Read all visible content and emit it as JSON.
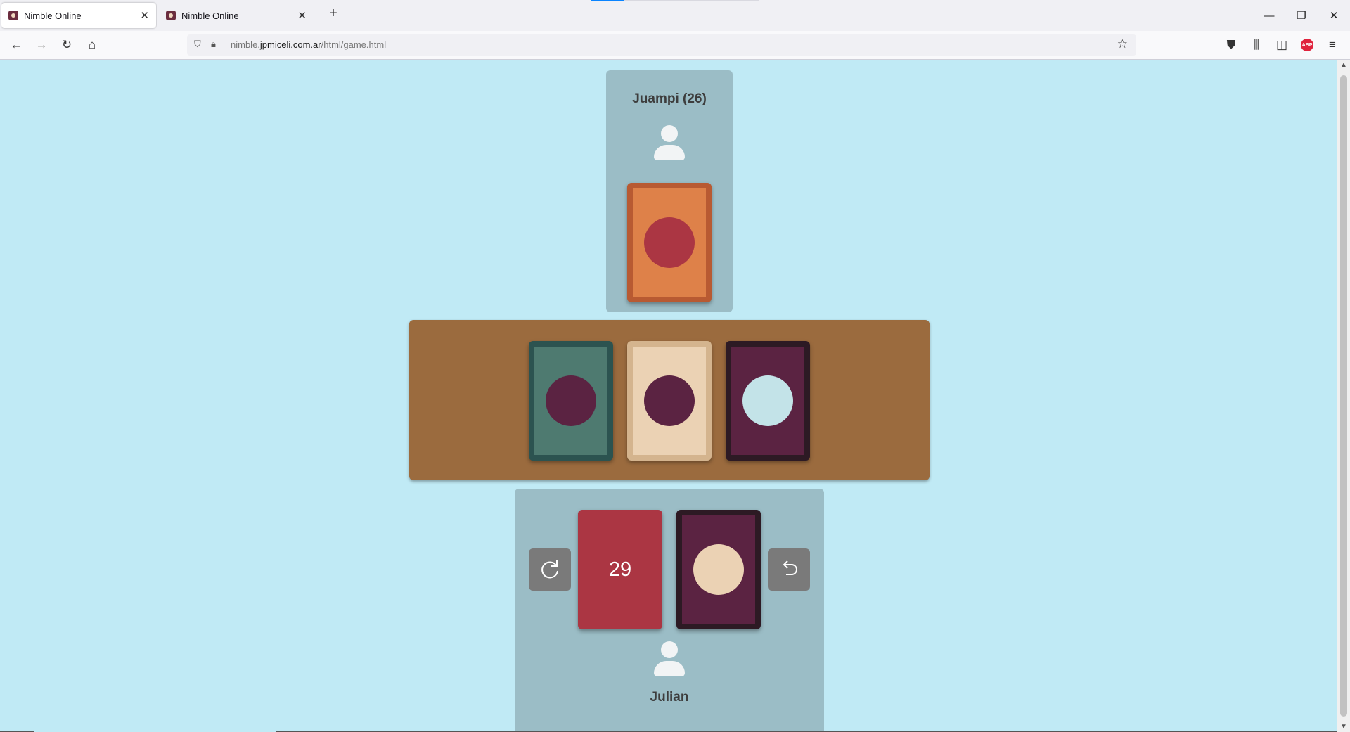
{
  "browser": {
    "tabs": [
      {
        "title": "Nimble Online",
        "active": true
      },
      {
        "title": "Nimble Online",
        "active": false
      }
    ],
    "url_prefix": "nimble.",
    "url_domain": "jpmiceli.com.ar",
    "url_path": "/html/game.html",
    "icons": {
      "back": "←",
      "forward": "→",
      "reload": "↻",
      "home": "⌂",
      "shield": "⛉",
      "lock": "🔒︎",
      "star": "☆",
      "minimize": "—",
      "restore": "❐",
      "close_window": "✕",
      "new_tab": "+",
      "tab_close": "✕",
      "pocket": "⛊",
      "library": "⫼",
      "sidebar": "◫",
      "menu": "≡"
    },
    "adblock_label": "ABP"
  },
  "game": {
    "opponent": {
      "name": "Juampi (26)"
    },
    "player": {
      "name": "Julian",
      "pile_count": "29"
    },
    "colors": {
      "orange": "#de8149",
      "orange_border": "#b85a32",
      "red": "#ab3643",
      "teal": "#4e7a70",
      "teal_border": "#2c5350",
      "cream": "#ebd2b4",
      "cream_border": "#d4b48e",
      "plum": "#5b2342",
      "plum_border": "#2d1a24",
      "light_blue": "#c3e3e8",
      "table_brown": "#9b6b3e",
      "panel": "#9bbdc6",
      "background": "#c0eaf5"
    }
  }
}
